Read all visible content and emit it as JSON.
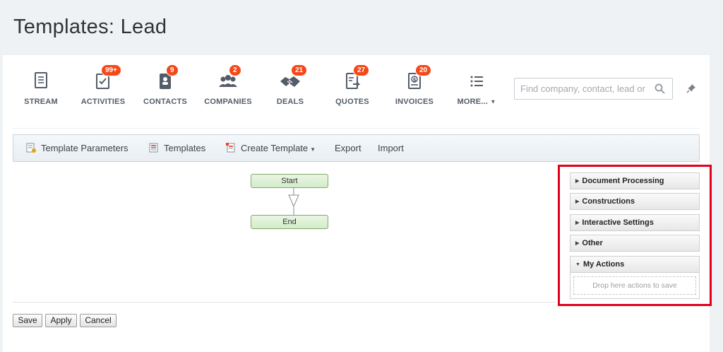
{
  "page": {
    "title": "Templates: Lead"
  },
  "nav": {
    "items": [
      {
        "label": "STREAM",
        "badge": "",
        "icon": "stream-icon"
      },
      {
        "label": "ACTIVITIES",
        "badge": "99+",
        "icon": "activities-icon"
      },
      {
        "label": "CONTACTS",
        "badge": "9",
        "icon": "contacts-icon"
      },
      {
        "label": "COMPANIES",
        "badge": "2",
        "icon": "companies-icon"
      },
      {
        "label": "DEALS",
        "badge": "21",
        "icon": "deals-icon"
      },
      {
        "label": "QUOTES",
        "badge": "27",
        "icon": "quotes-icon"
      },
      {
        "label": "INVOICES",
        "badge": "20",
        "icon": "invoices-icon"
      },
      {
        "label": "MORE...",
        "badge": "",
        "icon": "list-icon"
      }
    ],
    "search_placeholder": "Find company, contact, lead or"
  },
  "toolbar": {
    "template_parameters": "Template Parameters",
    "templates": "Templates",
    "create_template": "Create Template",
    "export": "Export",
    "import": "Import"
  },
  "designer": {
    "start_label": "Start",
    "end_label": "End"
  },
  "panel": {
    "categories": [
      "Document Processing",
      "Constructions",
      "Interactive Settings",
      "Other"
    ],
    "my_actions": "My Actions",
    "drop_hint": "Drop here actions to save"
  },
  "buttons": {
    "save": "Save",
    "apply": "Apply",
    "cancel": "Cancel"
  },
  "colors": {
    "badge": "#f54819",
    "highlight": "#e2001a",
    "block_fill": "#d3ecc8",
    "block_border": "#7fa86c"
  }
}
